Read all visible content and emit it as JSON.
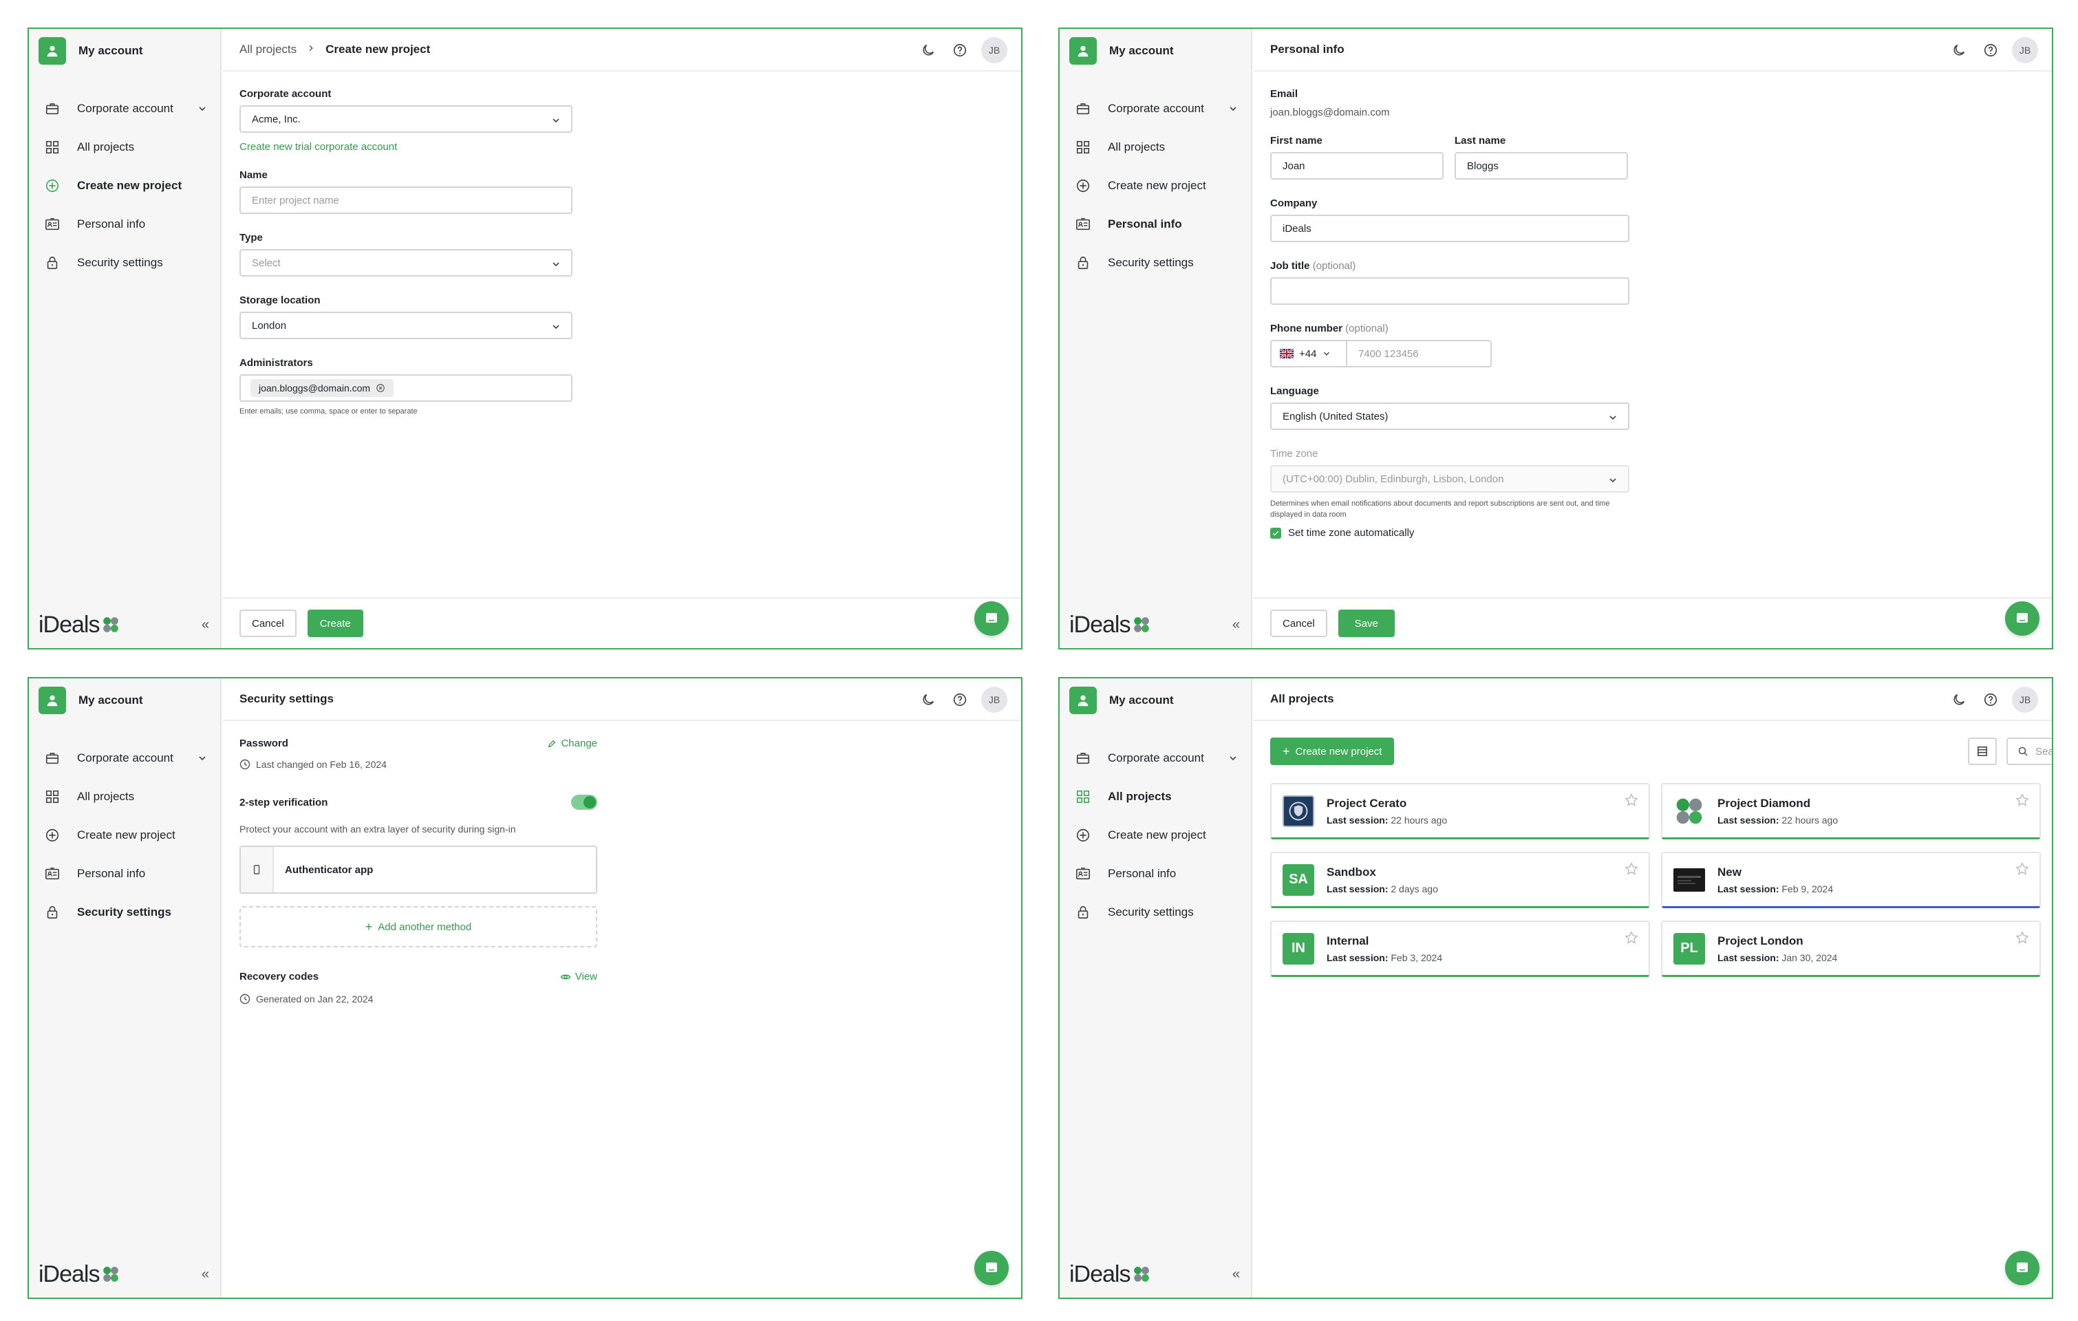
{
  "colors": {
    "accent": "#3dab57",
    "link": "#2f9e4a",
    "blue_underline": "#3b5bcc"
  },
  "sidebar": {
    "title": "My account",
    "items": [
      {
        "label": "Corporate account",
        "icon": "briefcase-icon"
      },
      {
        "label": "All projects",
        "icon": "grid-icon"
      },
      {
        "label": "Create new project",
        "icon": "plus-circle-icon"
      },
      {
        "label": "Personal info",
        "icon": "id-card-icon"
      },
      {
        "label": "Security settings",
        "icon": "lock-icon"
      }
    ],
    "logo": "iDeals",
    "collapse": "«"
  },
  "header": {
    "avatar_initials": "JB"
  },
  "create_project": {
    "breadcrumb": "All projects",
    "title": "Create new project",
    "corporate_account_label": "Corporate account",
    "corporate_account_value": "Acme, Inc.",
    "trial_link": "Create new trial corporate account",
    "name_label": "Name",
    "name_placeholder": "Enter project name",
    "type_label": "Type",
    "type_placeholder": "Select",
    "storage_label": "Storage location",
    "storage_value": "London",
    "admins_label": "Administrators",
    "admin_chip": "joan.bloggs@domain.com",
    "admins_help": "Enter emails; use comma, space or enter to separate",
    "cancel": "Cancel",
    "create": "Create"
  },
  "personal_info": {
    "title": "Personal info",
    "email_label": "Email",
    "email_value": "joan.bloggs@domain.com",
    "first_name_label": "First name",
    "first_name_value": "Joan",
    "last_name_label": "Last name",
    "last_name_value": "Bloggs",
    "company_label": "Company",
    "company_value": "iDeals",
    "job_title_label": "Job title",
    "optional": "(optional)",
    "phone_label": "Phone number",
    "phone_code": "+44",
    "phone_placeholder": "7400 123456",
    "language_label": "Language",
    "language_value": "English (United States)",
    "timezone_label": "Time zone",
    "timezone_value": "(UTC+00:00) Dublin, Edinburgh, Lisbon, London",
    "timezone_help": "Determines when email notifications about documents and report subscriptions are sent out, and time displayed in data room",
    "auto_tz": "Set time zone automatically",
    "cancel": "Cancel",
    "save": "Save"
  },
  "security": {
    "title": "Security settings",
    "password_label": "Password",
    "change": "Change",
    "password_changed": "Last changed on Feb 16, 2024",
    "two_step_label": "2-step verification",
    "two_step_desc": "Protect your account with an extra layer of security during sign-in",
    "method": "Authenticator app",
    "add_method": "Add another method",
    "recovery_label": "Recovery codes",
    "view": "View",
    "recovery_generated": "Generated on Jan 22, 2024"
  },
  "all_projects": {
    "title": "All projects",
    "create_button": "Create new project",
    "search_placeholder": "Search for project",
    "session_label": "Last session:",
    "projects": [
      {
        "name": "Project Cerato",
        "session": "22 hours ago",
        "thumb": "",
        "color": "#1f3c5e"
      },
      {
        "name": "Project Diamond",
        "session": "22 hours ago",
        "thumb": "",
        "color": "#ffffff"
      },
      {
        "name": "Sandbox",
        "session": "2 days ago",
        "thumb": "SA",
        "color": "#3dab57"
      },
      {
        "name": "New",
        "session": "Feb 9, 2024",
        "thumb": "",
        "color": "#1a1a1a"
      },
      {
        "name": "Internal",
        "session": "Feb 3, 2024",
        "thumb": "IN",
        "color": "#3dab57"
      },
      {
        "name": "Project London",
        "session": "Jan 30, 2024",
        "thumb": "PL",
        "color": "#3dab57"
      }
    ]
  }
}
